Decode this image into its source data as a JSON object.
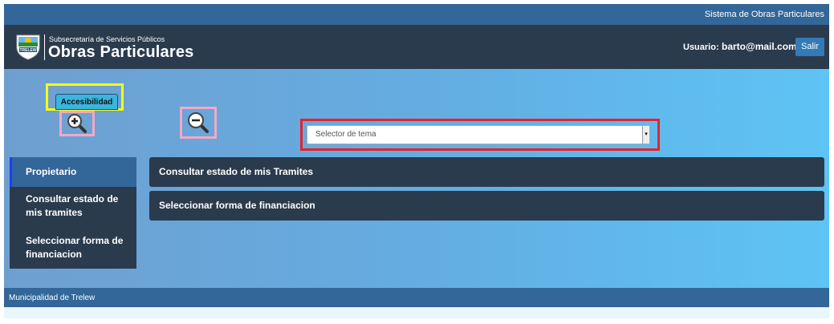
{
  "topbar": {
    "title": "Sistema de Obras Particulares"
  },
  "header": {
    "subtitle": "Subsecretaría de Servicios Públicos",
    "title": "Obras Particulares",
    "logo_text": "TRELEW",
    "user_label": "Usuario:",
    "user_email": "barto@mail.com",
    "logout_label": "Salir"
  },
  "accessibility": {
    "tab_label": "Accesibilidad",
    "zoom_in_icon": "zoom-in-icon",
    "zoom_out_icon": "zoom-out-icon"
  },
  "theme_selector": {
    "placeholder": "Selector de tema",
    "arrow": "▾"
  },
  "sidebar": {
    "items": [
      {
        "label": "Propietario",
        "active": true
      },
      {
        "label": "Consultar estado de mis tramites",
        "active": false
      },
      {
        "label": "Seleccionar forma de financiacion",
        "active": false
      }
    ]
  },
  "panels": [
    {
      "label": "Consultar estado de mis Tramites"
    },
    {
      "label": "Seleccionar forma de financiacion"
    }
  ],
  "footer": {
    "text": "Municipalidad de Trelew"
  },
  "colors": {
    "topbar": "#336699",
    "header": "#2b3b4e",
    "accent": "#337ab7",
    "highlight_yellow": "#ffff00",
    "highlight_pink": "#f4a7c6",
    "highlight_red": "#e8212b"
  }
}
